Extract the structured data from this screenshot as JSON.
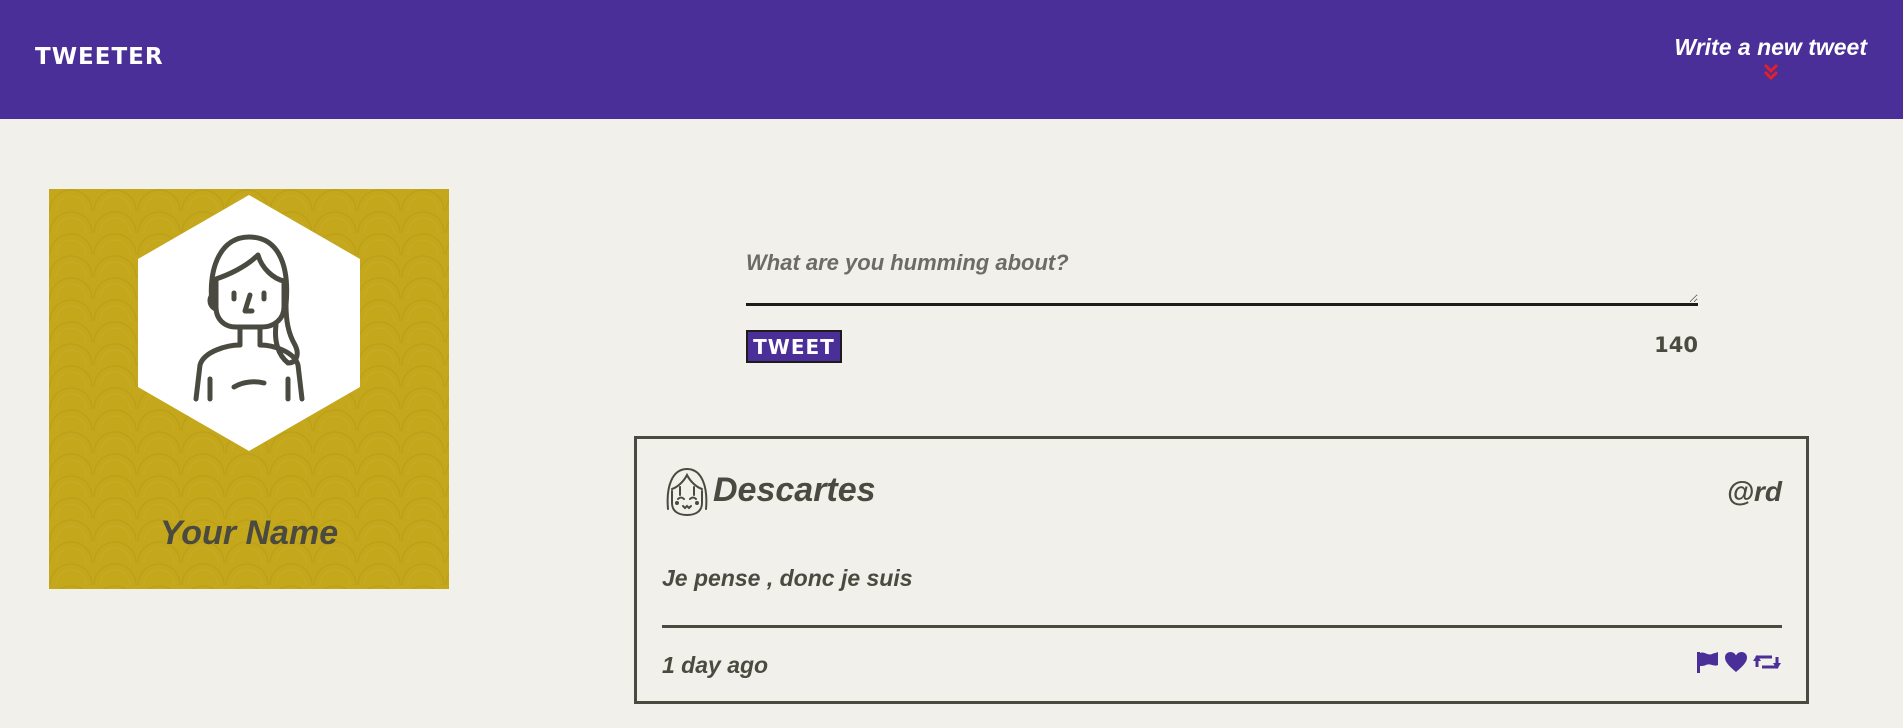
{
  "header": {
    "brand": "TWEETER",
    "write_label": "Write a new tweet",
    "write_icon": "double-chevron-down-icon",
    "accent_color": "#4a2f98",
    "chevron_color": "#e0202a"
  },
  "profile": {
    "name": "Your Name",
    "avatar_icon": "woman-avatar-icon",
    "background_color": "#c4a71b"
  },
  "composer": {
    "placeholder": "What are you humming about?",
    "value": "",
    "button_label": "TWEET",
    "counter": "140"
  },
  "tweets": [
    {
      "author": "Descartes",
      "handle": "@rd",
      "content": "Je pense , donc je suis",
      "time": "1 day ago",
      "avatar_icon": "girl-face-icon",
      "actions": [
        "flag-icon",
        "heart-icon",
        "retweet-icon"
      ]
    }
  ]
}
